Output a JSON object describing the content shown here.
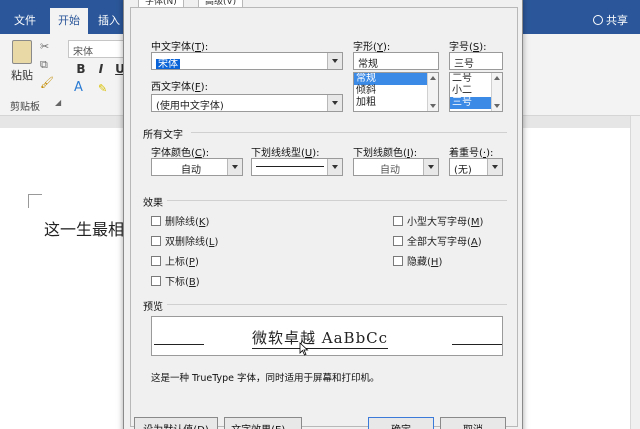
{
  "word": {
    "tabs": [
      "文件",
      "开始",
      "插入"
    ],
    "active_tab": "开始",
    "share": "共享",
    "font_name": "宋体",
    "paste": "粘贴",
    "clipboard": "剪贴板",
    "format_buttons": [
      "B",
      "I",
      "U"
    ],
    "body_text": "这一生最相"
  },
  "dialog": {
    "tabs": [
      "字体(N)",
      "高级(V)"
    ],
    "cn_font": {
      "label": "中文字体",
      "key": "T",
      "value": "宋体"
    },
    "west_font": {
      "label": "西文字体",
      "key": "F",
      "value": "(使用中文字体)"
    },
    "style": {
      "label": "字形",
      "key": "Y",
      "value": "常规",
      "items": [
        "常规",
        "倾斜",
        "加粗"
      ],
      "selected": 0
    },
    "size": {
      "label": "字号",
      "key": "S",
      "value": "三号",
      "items": [
        "二号",
        "小二",
        "三号"
      ],
      "selected": 2
    },
    "all_text": "所有文字",
    "font_color": {
      "label": "字体颜色",
      "key": "C",
      "value": "自动"
    },
    "underline_type": {
      "label": "下划线线型",
      "key": "U"
    },
    "underline_color": {
      "label": "下划线颜色",
      "key": "I",
      "value": "自动"
    },
    "emphasis": {
      "label": "着重号",
      "key": "·",
      "value": "(无)"
    },
    "effects_title": "效果",
    "effects_left": [
      {
        "label": "删除线",
        "key": "K"
      },
      {
        "label": "双删除线",
        "key": "L"
      },
      {
        "label": "上标",
        "key": "P"
      },
      {
        "label": "下标",
        "key": "B"
      }
    ],
    "effects_right": [
      {
        "label": "小型大写字母",
        "key": "M"
      },
      {
        "label": "全部大写字母",
        "key": "A"
      },
      {
        "label": "隐藏",
        "key": "H"
      }
    ],
    "preview_title": "预览",
    "preview_text": "微软卓越  AaBbCc",
    "preview_note": "这是一种 TrueType 字体，同时适用于屏幕和打印机。",
    "buttons": [
      "设为默认值(D)",
      "文字效果(E)...",
      "确定",
      "取消"
    ]
  },
  "colors": {
    "ribbon": "#2b579a",
    "selection": "#3b8ae6"
  }
}
